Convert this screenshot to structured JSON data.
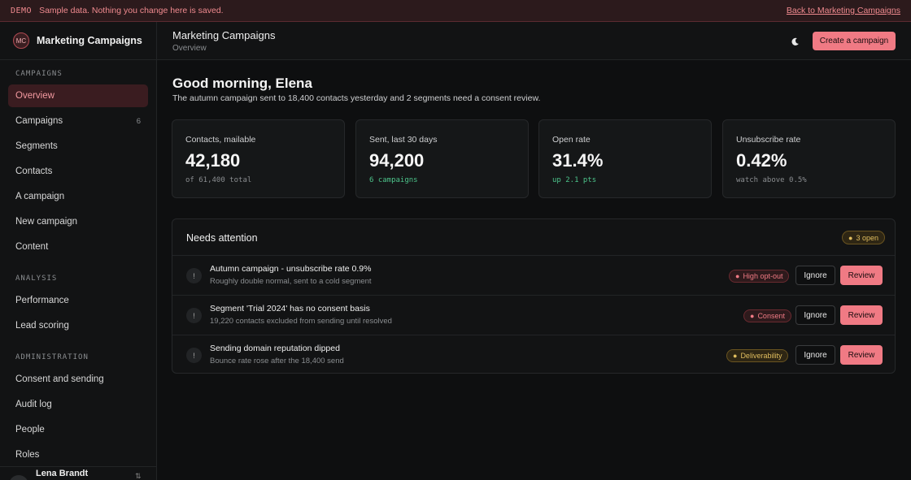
{
  "banner": {
    "tag": "DEMO",
    "message": "Sample data. Nothing you change here is saved.",
    "back_link": "Back to Marketing Campaigns"
  },
  "sidebar": {
    "logo_initials": "MC",
    "app_name": "Marketing Campaigns",
    "sections": [
      {
        "label": "CAMPAIGNS",
        "items": [
          {
            "label": "Overview",
            "active": true
          },
          {
            "label": "Campaigns",
            "count": "6"
          },
          {
            "label": "Segments"
          },
          {
            "label": "Contacts"
          },
          {
            "label": "A campaign"
          },
          {
            "label": "New campaign"
          },
          {
            "label": "Content"
          }
        ]
      },
      {
        "label": "ANALYSIS",
        "items": [
          {
            "label": "Performance"
          },
          {
            "label": "Lead scoring"
          }
        ]
      },
      {
        "label": "ADMINISTRATION",
        "items": [
          {
            "label": "Consent and sending"
          },
          {
            "label": "Audit log"
          },
          {
            "label": "People"
          },
          {
            "label": "Roles"
          }
        ]
      }
    ],
    "user": {
      "initials": "LB",
      "name": "Lena Brandt"
    }
  },
  "topbar": {
    "title": "Marketing Campaigns",
    "breadcrumb": "Overview",
    "theme_icon": "moon-icon",
    "cta": "Create a campaign"
  },
  "main": {
    "greeting": "Good morning, Elena",
    "subtitle": "The autumn campaign sent to 18,400 contacts yesterday and 2 segments need a consent review.",
    "stats": [
      {
        "label": "Contacts, mailable",
        "value": "42,180",
        "note": "of 61,400 total",
        "note_color": "muted"
      },
      {
        "label": "Sent, last 30 days",
        "value": "94,200",
        "note": "6 campaigns",
        "note_color": "green"
      },
      {
        "label": "Open rate",
        "value": "31.4%",
        "note": "up 2.1 pts",
        "note_color": "green"
      },
      {
        "label": "Unsubscribe rate",
        "value": "0.42%",
        "note": "watch above 0.5%",
        "note_color": "muted"
      }
    ],
    "attention": {
      "title": "Needs attention",
      "badge": "3 open",
      "rows": [
        {
          "title": "Autumn campaign - unsubscribe rate 0.9%",
          "detail": "Roughly double normal, sent to a cold segment",
          "tag": "High opt-out",
          "tag_color": "red",
          "ignore": "Ignore",
          "review": "Review"
        },
        {
          "title": "Segment 'Trial 2024' has no consent basis",
          "detail": "19,220 contacts excluded from sending until resolved",
          "tag": "Consent",
          "tag_color": "red",
          "ignore": "Ignore",
          "review": "Review"
        },
        {
          "title": "Sending domain reputation dipped",
          "detail": "Bounce rate rose after the 18,400 send",
          "tag": "Deliverability",
          "tag_color": "yellow",
          "ignore": "Ignore",
          "review": "Review"
        }
      ]
    }
  },
  "colors": {
    "accent": "#f07a84",
    "green": "#4cc38a",
    "warning": "#e0bd5e",
    "background": "#0e0f10"
  }
}
